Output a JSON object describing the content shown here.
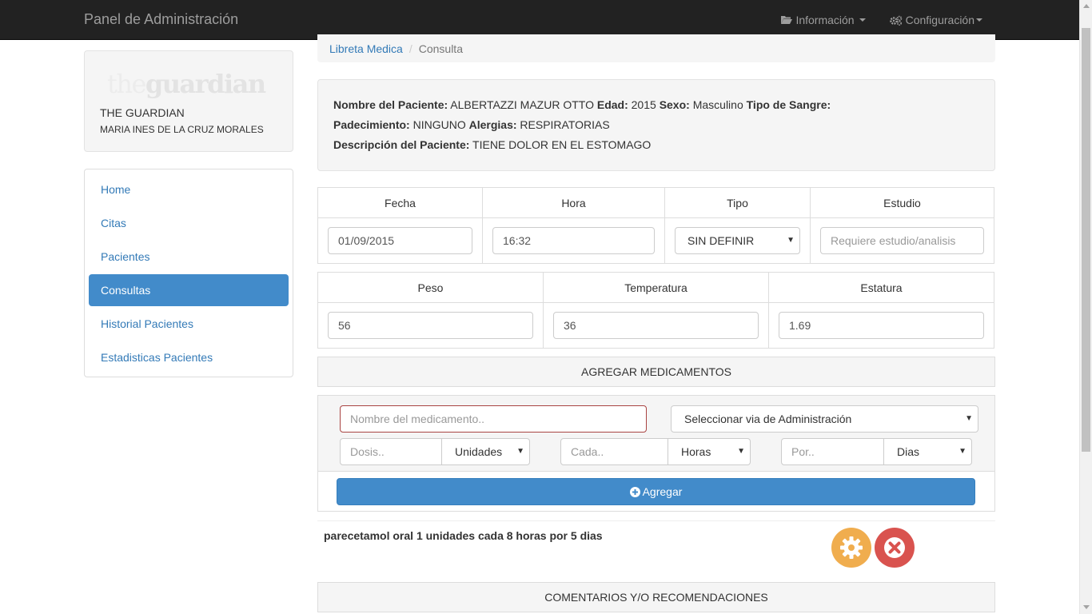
{
  "navbar": {
    "brand": "Panel de Administración",
    "info_label": "Información",
    "config_label": "Configuración"
  },
  "profile": {
    "logo_the": "the",
    "logo_main": "guardian",
    "org": "THE GUARDIAN",
    "user": "MARIA INES DE LA CRUZ MORALES"
  },
  "sidebar": {
    "items": [
      {
        "label": "Home"
      },
      {
        "label": "Citas"
      },
      {
        "label": "Pacientes"
      },
      {
        "label": "Consultas"
      },
      {
        "label": "Historial Pacientes"
      },
      {
        "label": "Estadisticas Pacientes"
      }
    ]
  },
  "breadcrumb": {
    "parent": "Libreta Medica",
    "current": "Consulta"
  },
  "patient": {
    "name_label": "Nombre del Paciente:",
    "name": "ALBERTAZZI MAZUR OTTO",
    "age_label": "Edad:",
    "age": "2015",
    "sex_label": "Sexo:",
    "sex": "Masculino",
    "blood_label": "Tipo de Sangre:",
    "condition_label": "Padecimiento:",
    "condition": "NINGUNO",
    "allergy_label": "Alergias:",
    "allergy": "RESPIRATORIAS",
    "desc_label": "Descripción del Paciente:",
    "desc": "TIENE DOLOR EN EL ESTOMAGO"
  },
  "consult": {
    "headers": [
      "Fecha",
      "Hora",
      "Tipo",
      "Estudio"
    ],
    "fecha": "01/09/2015",
    "hora": "16:32",
    "tipo": "SIN DEFINIR",
    "estudio_placeholder": "Requiere estudio/analisis"
  },
  "vitals": {
    "headers": [
      "Peso",
      "Temperatura",
      "Estatura"
    ],
    "peso": "56",
    "temperatura": "36",
    "estatura": "1.69"
  },
  "medications": {
    "section_title": "AGREGAR MEDICAMENTOS",
    "name_placeholder": "Nombre del medicamento..",
    "route_select": "Seleccionar via de Administración",
    "dose_placeholder": "Dosis..",
    "dose_unit": "Unidades",
    "every_placeholder": "Cada..",
    "every_unit": "Horas",
    "for_placeholder": "Por..",
    "for_unit": "Dias",
    "add_label": "Agregar",
    "entry": "parecetamol oral 1 unidades cada 8 horas por 5 dias"
  },
  "comments": {
    "section_title": "COMENTARIOS Y/O RECOMENDACIONES"
  },
  "colors": {
    "primary": "#428bca",
    "warning": "#f0ad4e",
    "danger": "#d9534f",
    "navbar": "#222222"
  }
}
